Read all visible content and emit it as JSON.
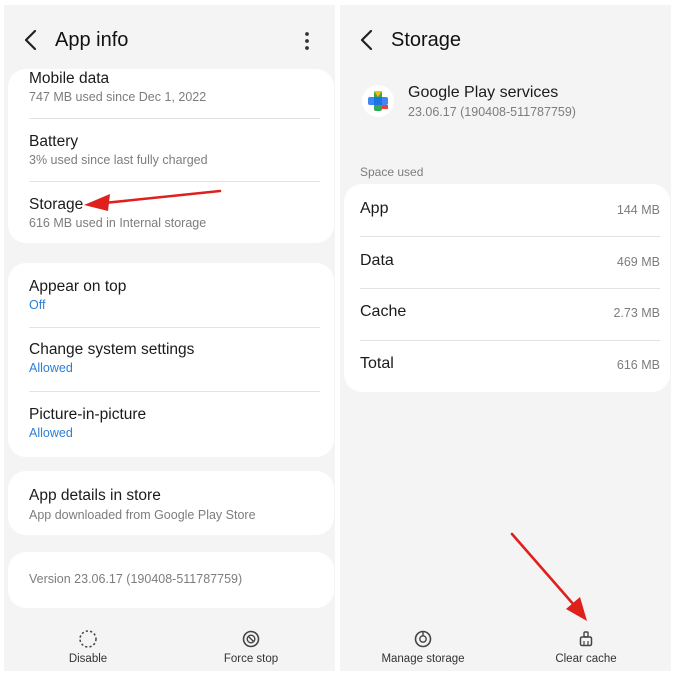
{
  "left": {
    "header": {
      "title": "App info",
      "back_icon": "back-arrow-icon",
      "menu_icon": "more-vertical-icon"
    },
    "rows": {
      "mobile_data": {
        "title": "Mobile data",
        "subtitle": "747 MB used since Dec 1, 2022"
      },
      "battery": {
        "title": "Battery",
        "subtitle": "3% used since last fully charged"
      },
      "storage": {
        "title": "Storage",
        "subtitle": "616 MB used in Internal storage"
      },
      "appear_on_top": {
        "title": "Appear on top",
        "subtitle": "Off"
      },
      "change_system_settings": {
        "title": "Change system settings",
        "subtitle": "Allowed"
      },
      "picture_in_picture": {
        "title": "Picture-in-picture",
        "subtitle": "Allowed"
      },
      "app_details": {
        "title": "App details in store",
        "subtitle": "App downloaded from Google Play Store"
      }
    },
    "version": "Version 23.06.17 (190408-511787759)",
    "bottom": {
      "disable": "Disable",
      "force_stop": "Force stop"
    }
  },
  "right": {
    "header": {
      "title": "Storage",
      "back_icon": "back-arrow-icon"
    },
    "app": {
      "name": "Google Play services",
      "version": "23.06.17 (190408-511787759)",
      "icon": "google-play-services-icon"
    },
    "section_label": "Space used",
    "storage": {
      "app": {
        "label": "App",
        "value": "144 MB"
      },
      "data": {
        "label": "Data",
        "value": "469 MB"
      },
      "cache": {
        "label": "Cache",
        "value": "2.73 MB"
      },
      "total": {
        "label": "Total",
        "value": "616 MB"
      }
    },
    "bottom": {
      "manage_storage": "Manage storage",
      "clear_cache": "Clear cache"
    }
  },
  "colors": {
    "panel_bg": "#f4f4f4",
    "card_bg": "#ffffff",
    "link_blue": "#2c7fd6",
    "annotation_red": "#e0201c"
  }
}
